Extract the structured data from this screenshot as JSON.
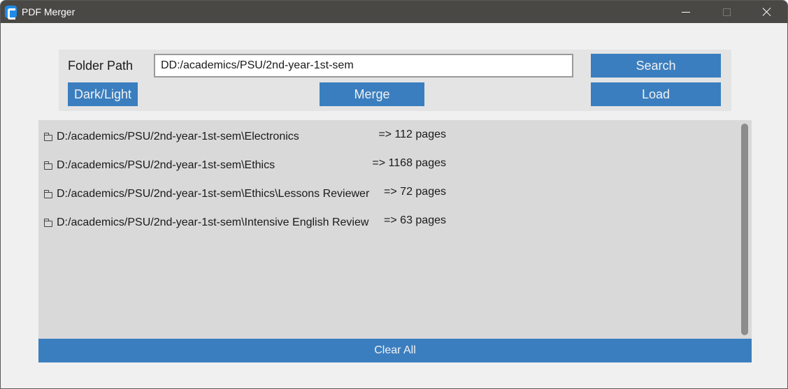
{
  "window": {
    "title": "PDF Merger"
  },
  "toolbar": {
    "folder_label": "Folder Path",
    "path_value": "DD:/academics/PSU/2nd-year-1st-sem",
    "search_label": "Search",
    "darklight_label": "Dark/Light",
    "merge_label": "Merge",
    "load_label": "Load"
  },
  "list": {
    "items": [
      {
        "icon": "folder-icon",
        "path": "D:/academics/PSU/2nd-year-1st-sem\\Electronics",
        "pages": "=> 112 pages"
      },
      {
        "icon": "folder-icon",
        "path": "D:/academics/PSU/2nd-year-1st-sem\\Ethics",
        "pages": "=> 1168 pages"
      },
      {
        "icon": "folder-icon",
        "path": "D:/academics/PSU/2nd-year-1st-sem\\Ethics\\Lessons Reviewer",
        "pages": "=> 72 pages"
      },
      {
        "icon": "folder-icon",
        "path": "D:/academics/PSU/2nd-year-1st-sem\\Intensive English Review",
        "pages": "=> 63 pages"
      }
    ]
  },
  "footer": {
    "clear_label": "Clear All"
  },
  "colors": {
    "accent": "#3a7ebf",
    "titlebar": "#4a4845",
    "list_bg": "#d9d9d9"
  }
}
